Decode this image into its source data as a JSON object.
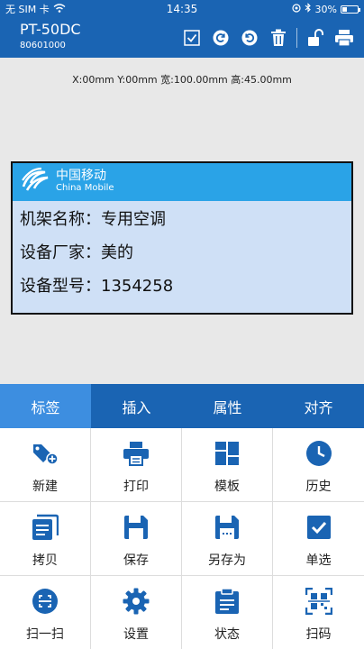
{
  "status_bar": {
    "carrier": "无 SIM 卡",
    "time": "14:35",
    "battery_text": "30%",
    "battery_level": 0.3
  },
  "header": {
    "model": "PT-50DC",
    "serial": "80601000"
  },
  "toolbar": {
    "icons": [
      "checkbox-icon",
      "rotate-left-icon",
      "rotate-right-icon",
      "trash-icon",
      "unlock-icon",
      "printer-icon"
    ]
  },
  "canvas": {
    "coords": "X:00mm  Y:00mm  宽:100.00mm  高:45.00mm"
  },
  "label": {
    "brand_cn": "中国移动",
    "brand_en": "China Mobile",
    "rows": [
      "机架名称：专用空调",
      "设备厂家：美的",
      "设备型号：1354258"
    ]
  },
  "tabs": [
    {
      "label": "标签",
      "active": true
    },
    {
      "label": "插入",
      "active": false
    },
    {
      "label": "属性",
      "active": false
    },
    {
      "label": "对齐",
      "active": false
    }
  ],
  "grid": [
    {
      "label": "新建",
      "icon": "tag-add-icon"
    },
    {
      "label": "打印",
      "icon": "printer-icon"
    },
    {
      "label": "模板",
      "icon": "template-icon"
    },
    {
      "label": "历史",
      "icon": "clock-icon"
    },
    {
      "label": "拷贝",
      "icon": "copy-icon"
    },
    {
      "label": "保存",
      "icon": "save-icon"
    },
    {
      "label": "另存为",
      "icon": "save-as-icon"
    },
    {
      "label": "单选",
      "icon": "checkbox-icon"
    },
    {
      "label": "扫一扫",
      "icon": "scan-icon"
    },
    {
      "label": "设置",
      "icon": "gear-icon"
    },
    {
      "label": "状态",
      "icon": "clipboard-icon"
    },
    {
      "label": "扫码",
      "icon": "qr-scan-icon"
    }
  ],
  "colors": {
    "primary": "#1a64b3",
    "tab_active": "#3d8ee0",
    "label_header": "#2aa3e7",
    "label_body": "#cfe0f6",
    "icon": "#1a64b3"
  }
}
